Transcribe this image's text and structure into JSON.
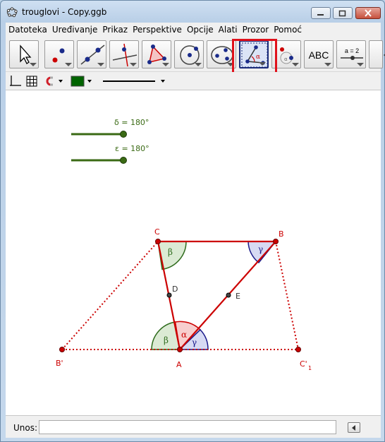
{
  "window": {
    "title": "trouglovi - Copy.ggb"
  },
  "menu": [
    "Datoteka",
    "Uređivanje",
    "Prikaz",
    "Perspektive",
    "Opcije",
    "Alati",
    "Prozor",
    "Pomoć"
  ],
  "toolbar": {
    "tools": [
      {
        "name": "move-tool-button"
      },
      {
        "name": "point-tool-button"
      },
      {
        "name": "line-tool-button"
      },
      {
        "name": "perpendicular-line-tool-button"
      },
      {
        "name": "polygon-tool-button"
      },
      {
        "name": "circle-tool-button"
      },
      {
        "name": "conic-tool-button"
      },
      {
        "name": "angle-tool-button",
        "selected": true
      },
      {
        "name": "transform-tool-button"
      },
      {
        "name": "text-tool-button",
        "label": "ABC"
      },
      {
        "name": "slider-tool-button",
        "label": "a = 2"
      }
    ],
    "highlight_color": "#e0121c"
  },
  "stylebar": {
    "color": "#006400"
  },
  "canvas": {
    "colors": {
      "slider": "#3a6a14",
      "triangle": "#cc0000",
      "point": "#cc0000",
      "angle_beta": "#2e6b1c",
      "angle_gamma": "#1a1a8a",
      "angle_alpha": "#cc0000"
    },
    "sliders": [
      {
        "label": "δ = 180°"
      },
      {
        "label": "ε = 180°"
      }
    ],
    "points": {
      "C": "C",
      "B": "B",
      "D": "D",
      "E": "E",
      "A": "A",
      "B1": "B'",
      "C1": "C'",
      "C1_sub": "1"
    },
    "angles": {
      "alpha": "α",
      "beta": "β",
      "gamma": "γ"
    }
  },
  "input": {
    "label": "Unos:",
    "value": ""
  }
}
